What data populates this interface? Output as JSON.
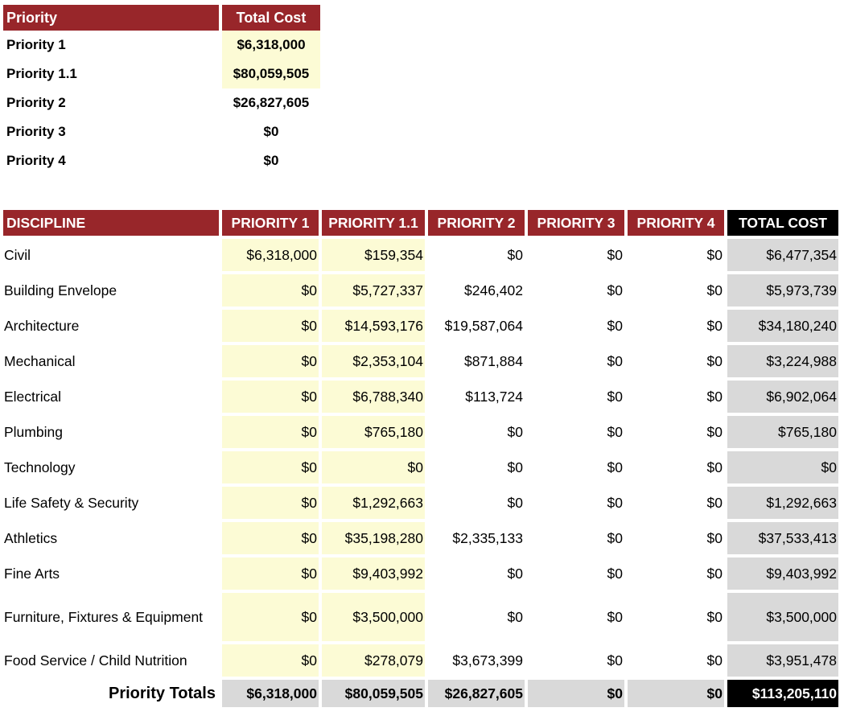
{
  "summary": {
    "headers": {
      "priority": "Priority",
      "total_cost": "Total Cost"
    },
    "rows": [
      {
        "label": "Priority 1",
        "cost": "$6,318,000"
      },
      {
        "label": "Priority 1.1",
        "cost": "$80,059,505"
      },
      {
        "label": "Priority 2",
        "cost": "$26,827,605"
      },
      {
        "label": "Priority 3",
        "cost": "$0"
      },
      {
        "label": "Priority 4",
        "cost": "$0"
      }
    ]
  },
  "disciplines": {
    "headers": {
      "discipline": "DISCIPLINE",
      "p1": "PRIORITY 1",
      "p11": "PRIORITY 1.1",
      "p2": "PRIORITY 2",
      "p3": "PRIORITY 3",
      "p4": "PRIORITY 4",
      "total": "TOTAL COST"
    },
    "rows": [
      {
        "name": "Civil",
        "p1": "$6,318,000",
        "p11": "$159,354",
        "p2": "$0",
        "p3": "$0",
        "p4": "$0",
        "total": "$6,477,354"
      },
      {
        "name": "Building Envelope",
        "p1": "$0",
        "p11": "$5,727,337",
        "p2": "$246,402",
        "p3": "$0",
        "p4": "$0",
        "total": "$5,973,739"
      },
      {
        "name": "Architecture",
        "p1": "$0",
        "p11": "$14,593,176",
        "p2": "$19,587,064",
        "p3": "$0",
        "p4": "$0",
        "total": "$34,180,240"
      },
      {
        "name": "Mechanical",
        "p1": "$0",
        "p11": "$2,353,104",
        "p2": "$871,884",
        "p3": "$0",
        "p4": "$0",
        "total": "$3,224,988"
      },
      {
        "name": "Electrical",
        "p1": "$0",
        "p11": "$6,788,340",
        "p2": "$113,724",
        "p3": "$0",
        "p4": "$0",
        "total": "$6,902,064"
      },
      {
        "name": "Plumbing",
        "p1": "$0",
        "p11": "$765,180",
        "p2": "$0",
        "p3": "$0",
        "p4": "$0",
        "total": "$765,180"
      },
      {
        "name": "Technology",
        "p1": "$0",
        "p11": "$0",
        "p2": "$0",
        "p3": "$0",
        "p4": "$0",
        "total": "$0"
      },
      {
        "name": "Life Safety & Security",
        "p1": "$0",
        "p11": "$1,292,663",
        "p2": "$0",
        "p3": "$0",
        "p4": "$0",
        "total": "$1,292,663"
      },
      {
        "name": "Athletics",
        "p1": "$0",
        "p11": "$35,198,280",
        "p2": "$2,335,133",
        "p3": "$0",
        "p4": "$0",
        "total": "$37,533,413"
      },
      {
        "name": "Fine Arts",
        "p1": "$0",
        "p11": "$9,403,992",
        "p2": "$0",
        "p3": "$0",
        "p4": "$0",
        "total": "$9,403,992"
      },
      {
        "name": "Furniture, Fixtures & Equipment",
        "p1": "$0",
        "p11": "$3,500,000",
        "p2": "$0",
        "p3": "$0",
        "p4": "$0",
        "total": "$3,500,000"
      },
      {
        "name": "Food Service / Child Nutrition",
        "p1": "$0",
        "p11": "$278,079",
        "p2": "$3,673,399",
        "p3": "$0",
        "p4": "$0",
        "total": "$3,951,478"
      }
    ],
    "totals": {
      "label": "Priority Totals",
      "p1": "$6,318,000",
      "p11": "$80,059,505",
      "p2": "$26,827,605",
      "p3": "$0",
      "p4": "$0",
      "total": "$113,205,110"
    }
  },
  "colors": {
    "header_red": "#98262a",
    "highlight_yellow": "#fcfbd5",
    "total_gray": "#d9d9d9",
    "grand_total_black": "#000000"
  }
}
